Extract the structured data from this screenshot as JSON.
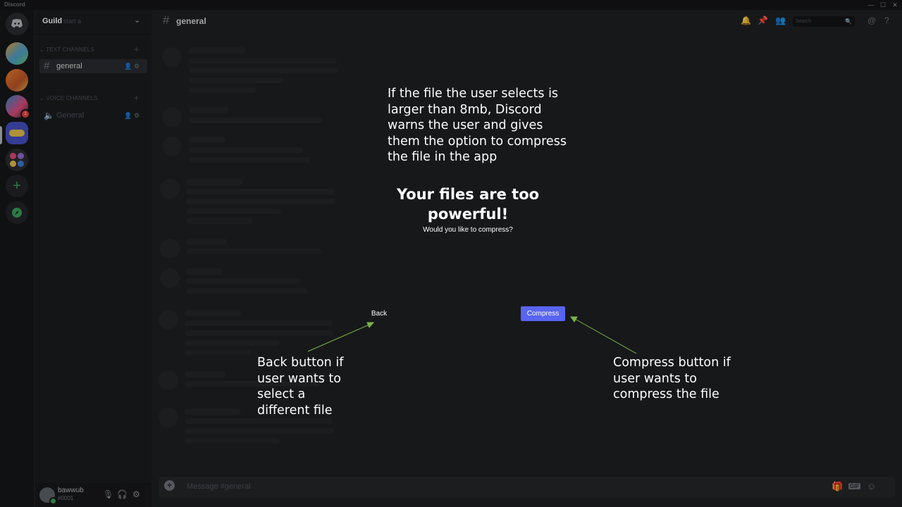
{
  "window": {
    "app_title": "Discord",
    "controls": [
      "—",
      "☐",
      "✕"
    ]
  },
  "server_rail": {
    "home_icon": "discord-logo-icon",
    "add_server": "+",
    "explore_icon": "compass-icon",
    "badge": "1"
  },
  "guild": {
    "name": "Guild",
    "ghost_text": "start a",
    "categories": [
      {
        "label": "TEXT CHANNELS",
        "channels": [
          {
            "label": "general",
            "type": "text"
          }
        ]
      },
      {
        "label": "VOICE CHANNELS",
        "channels": [
          {
            "label": "General",
            "type": "voice"
          }
        ]
      }
    ]
  },
  "user": {
    "name": "bawwub",
    "tag": "#0001"
  },
  "channel_header": {
    "hash": "#",
    "name": "general",
    "search_placeholder": "Search"
  },
  "composer": {
    "placeholder": "Message #general",
    "gif_label": "GIF"
  },
  "modal": {
    "title": "Your files are too powerful!",
    "subtitle": "Would you like to compress?",
    "back_label": "Back",
    "compress_label": "Compress"
  },
  "annotations": {
    "top": "If the file the user selects is larger than 8mb, Discord warns the user and gives them the option to compress the file in the app",
    "back": "Back button if user wants to select a different file",
    "compress": "Compress button if user wants to compress the file",
    "arrow_color": "#7ab648"
  },
  "colors": {
    "accent": "#5865f2",
    "online": "#3ba55c",
    "badge": "#ed4245"
  }
}
